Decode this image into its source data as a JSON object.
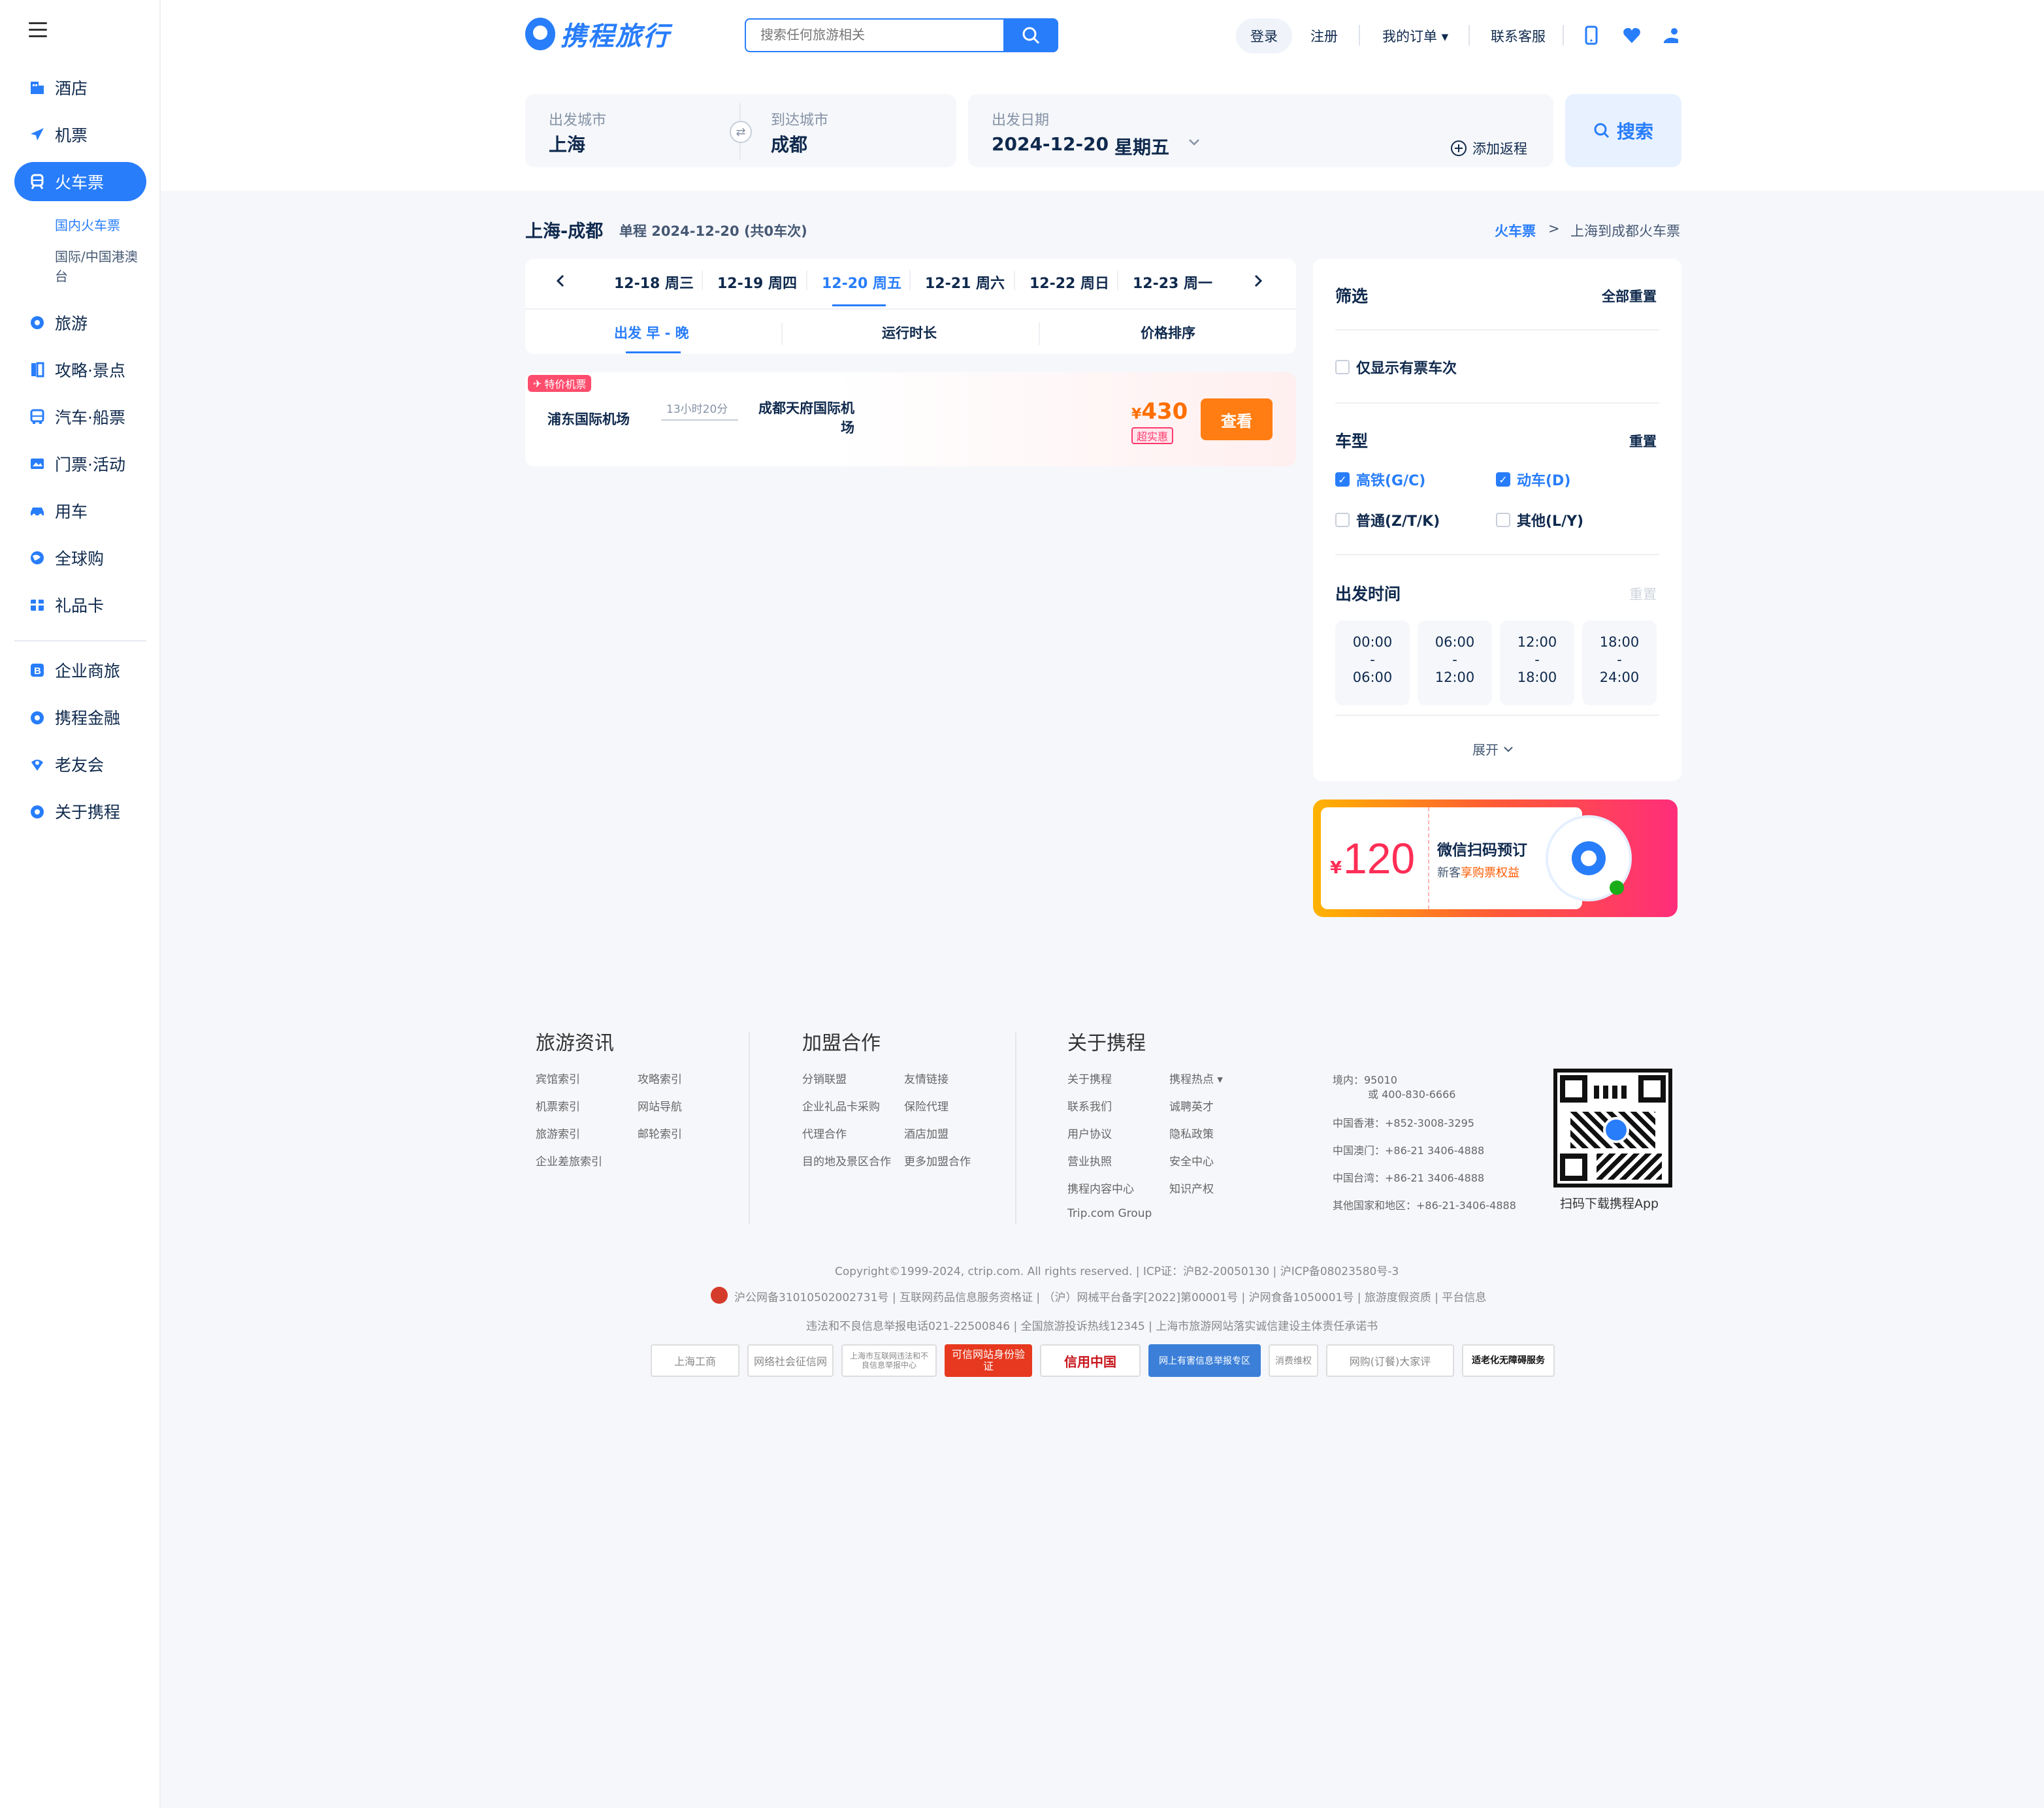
{
  "sidebar": {
    "items": [
      {
        "label": "酒店",
        "icon": "hotel-icon"
      },
      {
        "label": "机票",
        "icon": "plane-icon"
      },
      {
        "label": "火车票",
        "icon": "train-icon"
      },
      {
        "label": "旅游",
        "icon": "travel-icon"
      },
      {
        "label": "攻略·景点",
        "icon": "guide-icon"
      },
      {
        "label": "汽车·船票",
        "icon": "bus-icon"
      },
      {
        "label": "门票·活动",
        "icon": "ticket-icon"
      },
      {
        "label": "用车",
        "icon": "car-icon"
      },
      {
        "label": "全球购",
        "icon": "globe-icon"
      },
      {
        "label": "礼品卡",
        "icon": "giftcard-icon"
      },
      {
        "label": "企业商旅",
        "icon": "business-icon"
      },
      {
        "label": "携程金融",
        "icon": "finance-icon"
      },
      {
        "label": "老友会",
        "icon": "club-icon"
      },
      {
        "label": "关于携程",
        "icon": "about-icon"
      }
    ],
    "sub_items": [
      "国内火车票",
      "国际/中国港澳台"
    ]
  },
  "header": {
    "logo_text": "携程旅行",
    "search_placeholder": "搜索任何旅游相关",
    "login": "登录",
    "register": "注册",
    "orders": "我的订单 ▾",
    "service": "联系客服"
  },
  "search_form": {
    "from_label": "出发城市",
    "from_value": "上海",
    "to_label": "到达城市",
    "to_value": "成都",
    "date_label": "出发日期",
    "date_value": "2024-12-20",
    "weekday": "星期五",
    "add_return": "添加返程",
    "search_button": "搜索"
  },
  "results": {
    "route": "上海-成都",
    "summary": "单程 2024-12-20 (共0车次)",
    "breadcrumb_link": "火车票",
    "breadcrumb_sep": ">",
    "breadcrumb_current": "上海到成都火车票",
    "date_tabs": [
      "12-18 周三",
      "12-19 周四",
      "12-20 周五",
      "12-21 周六",
      "12-22 周日",
      "12-23 周一"
    ],
    "sort_tabs": [
      "出发 早 - 晚",
      "运行时长",
      "价格排序"
    ]
  },
  "flight_promo": {
    "tag": "特价机票",
    "from_airport": "浦东国际机场",
    "duration": "13小时20分",
    "to_airport": "成都天府国际机场",
    "currency": "¥",
    "price": "430",
    "price_tag": "超实惠",
    "view_button": "查看"
  },
  "filter": {
    "title": "筛选",
    "reset_all": "全部重置",
    "only_available": "仅显示有票车次",
    "train_type_title": "车型",
    "train_type_reset": "重置",
    "types": [
      {
        "label": "高铁(G/C)",
        "checked": true
      },
      {
        "label": "动车(D)",
        "checked": true
      },
      {
        "label": "普通(Z/T/K)",
        "checked": false
      },
      {
        "label": "其他(L/Y)",
        "checked": false
      }
    ],
    "depart_time_title": "出发时间",
    "depart_time_reset": "重置",
    "time_ranges": [
      {
        "start": "00:00",
        "end": "06:00"
      },
      {
        "start": "06:00",
        "end": "12:00"
      },
      {
        "start": "12:00",
        "end": "18:00"
      },
      {
        "start": "18:00",
        "end": "24:00"
      }
    ],
    "expand": "展开"
  },
  "wechat_promo": {
    "currency": "¥",
    "amount": "120",
    "title": "微信扫码预订",
    "subtitle_prefix": "新客",
    "subtitle_highlight": "享购票权益"
  },
  "footer": {
    "col1": {
      "title": "旅游资讯",
      "links": [
        "宾馆索引",
        "攻略索引",
        "机票索引",
        "网站导航",
        "旅游索引",
        "邮轮索引",
        "企业差旅索引"
      ]
    },
    "col2": {
      "title": "加盟合作",
      "links": [
        "分销联盟",
        "友情链接",
        "企业礼品卡采购",
        "保险代理",
        "代理合作",
        "酒店加盟",
        "目的地及景区合作",
        "更多加盟合作"
      ]
    },
    "col3": {
      "title": "关于携程",
      "links": [
        "关于携程",
        "携程热点 ▾",
        "联系我们",
        "诚聘英才",
        "用户协议",
        "隐私政策",
        "营业执照",
        "安全中心",
        "携程内容中心",
        "知识产权",
        "Trip.com Group"
      ]
    },
    "contacts": [
      "境内：95010",
      "或 400-830-6666",
      "中国香港：+852-3008-3295",
      "中国澳门：+86-21 3406-4888",
      "中国台湾：+86-21 3406-4888",
      "其他国家和地区：+86-21-3406-4888"
    ],
    "qr_caption": "扫码下载携程App",
    "copyright": "Copyright©1999-2024, ctrip.com. All rights reserved. | ICP证：沪B2-20050130 | 沪ICP备08023580号-3",
    "license": "沪公网备31010502002731号 | 互联网药品信息服务资格证 | （沪）网械平台备字[2022]第00001号 | 沪网食备1050001号 | 旅游度假资质 | 平台信息",
    "report": "违法和不良信息举报电话021-22500846 | 全国旅游投诉热线12345 | 上海市旅游网站落实诚信建设主体责任承诺书",
    "badges": [
      "上海工商",
      "网络社会征信网",
      "上海市互联网违法和不良信息举报中心",
      "可信网站身份验证",
      "信用中国",
      "网上有害信息举报专区",
      "消费维权",
      "网购(订餐)大家评",
      "适老化无障碍服务"
    ]
  },
  "colors": {
    "brand": "#287dfa",
    "orange": "#ff7d13",
    "price": "#ff6f00",
    "promo": "#ff3a6d"
  }
}
